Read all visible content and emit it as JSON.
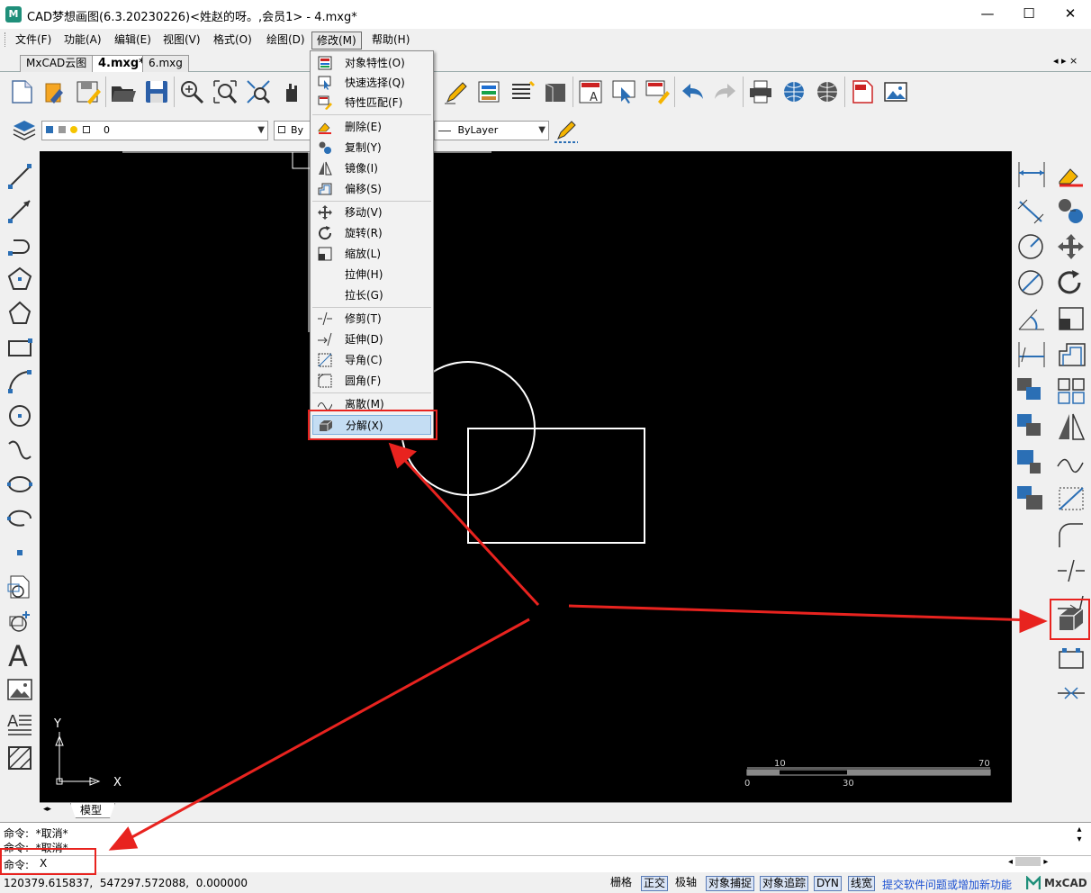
{
  "app": {
    "title": "CAD梦想画图(6.3.20230226)<姓赵的呀。,会员1> - 4.mxg*",
    "icon": "mxcad-app-icon"
  },
  "window": {
    "minimize": "—",
    "maximize": "☐",
    "close": "✕"
  },
  "menubar": [
    "文件(F)",
    "功能(A)",
    "编辑(E)",
    "视图(V)",
    "格式(O)",
    "绘图(D)",
    "修改(M)",
    "帮助(H)"
  ],
  "tabs": [
    "MxCAD云图",
    "4.mxg*",
    "6.mxg"
  ],
  "tab_nav": "◂ ▸ ×",
  "layer": {
    "name": "0",
    "color_prefix": "By",
    "linetype": "ByLayer"
  },
  "modify_menu": {
    "items": [
      {
        "label": "对象特性(O)",
        "icon": "properties-icon"
      },
      {
        "label": "快速选择(Q)",
        "icon": "quick-select-icon"
      },
      {
        "label": "特性匹配(F)",
        "icon": "match-properties-icon"
      },
      {
        "label": "删除(E)",
        "icon": "erase-icon"
      },
      {
        "label": "复制(Y)",
        "icon": "copy-icon"
      },
      {
        "label": "镜像(I)",
        "icon": "mirror-icon"
      },
      {
        "label": "偏移(S)",
        "icon": "offset-icon"
      },
      {
        "label": "移动(V)",
        "icon": "move-icon"
      },
      {
        "label": "旋转(R)",
        "icon": "rotate-icon"
      },
      {
        "label": "缩放(L)",
        "icon": "scale-icon"
      },
      {
        "label": "拉伸(H)",
        "icon": ""
      },
      {
        "label": "拉长(G)",
        "icon": ""
      },
      {
        "label": "修剪(T)",
        "icon": "trim-icon"
      },
      {
        "label": "延伸(D)",
        "icon": "extend-icon"
      },
      {
        "label": "导角(C)",
        "icon": "chamfer-icon"
      },
      {
        "label": "圆角(F)",
        "icon": "fillet-icon"
      },
      {
        "label": "离散(M)",
        "icon": "divide-icon"
      },
      {
        "label": "分解(X)",
        "icon": "explode-icon"
      }
    ],
    "highlighted": "分解(X)"
  },
  "canvas": {
    "ucs_x": "X",
    "ucs_y": "Y",
    "scale_labels": {
      "t1": "10",
      "t2": "70",
      "b1": "0",
      "b2": "30"
    }
  },
  "model_tab": "模型",
  "command": {
    "lines": [
      "命令:  *取消*",
      "命令:  *取消*"
    ],
    "prompt": "命令:",
    "input": "X"
  },
  "status": {
    "coords": "120379.615837,  547297.572088,  0.000000",
    "toggles": [
      {
        "label": "栅格",
        "on": false
      },
      {
        "label": "正交",
        "on": true
      },
      {
        "label": "极轴",
        "on": false
      },
      {
        "label": "对象捕捉",
        "on": true
      },
      {
        "label": "对象追踪",
        "on": true
      },
      {
        "label": "DYN",
        "on": true
      },
      {
        "label": "线宽",
        "on": true
      }
    ],
    "feedback_link": "提交软件问题或增加新功能",
    "brand": "MxCAD"
  },
  "colors": {
    "accent_red": "#e8231f",
    "menu_highlight": "#c4ddf3",
    "link_blue": "#1a4fd1"
  }
}
